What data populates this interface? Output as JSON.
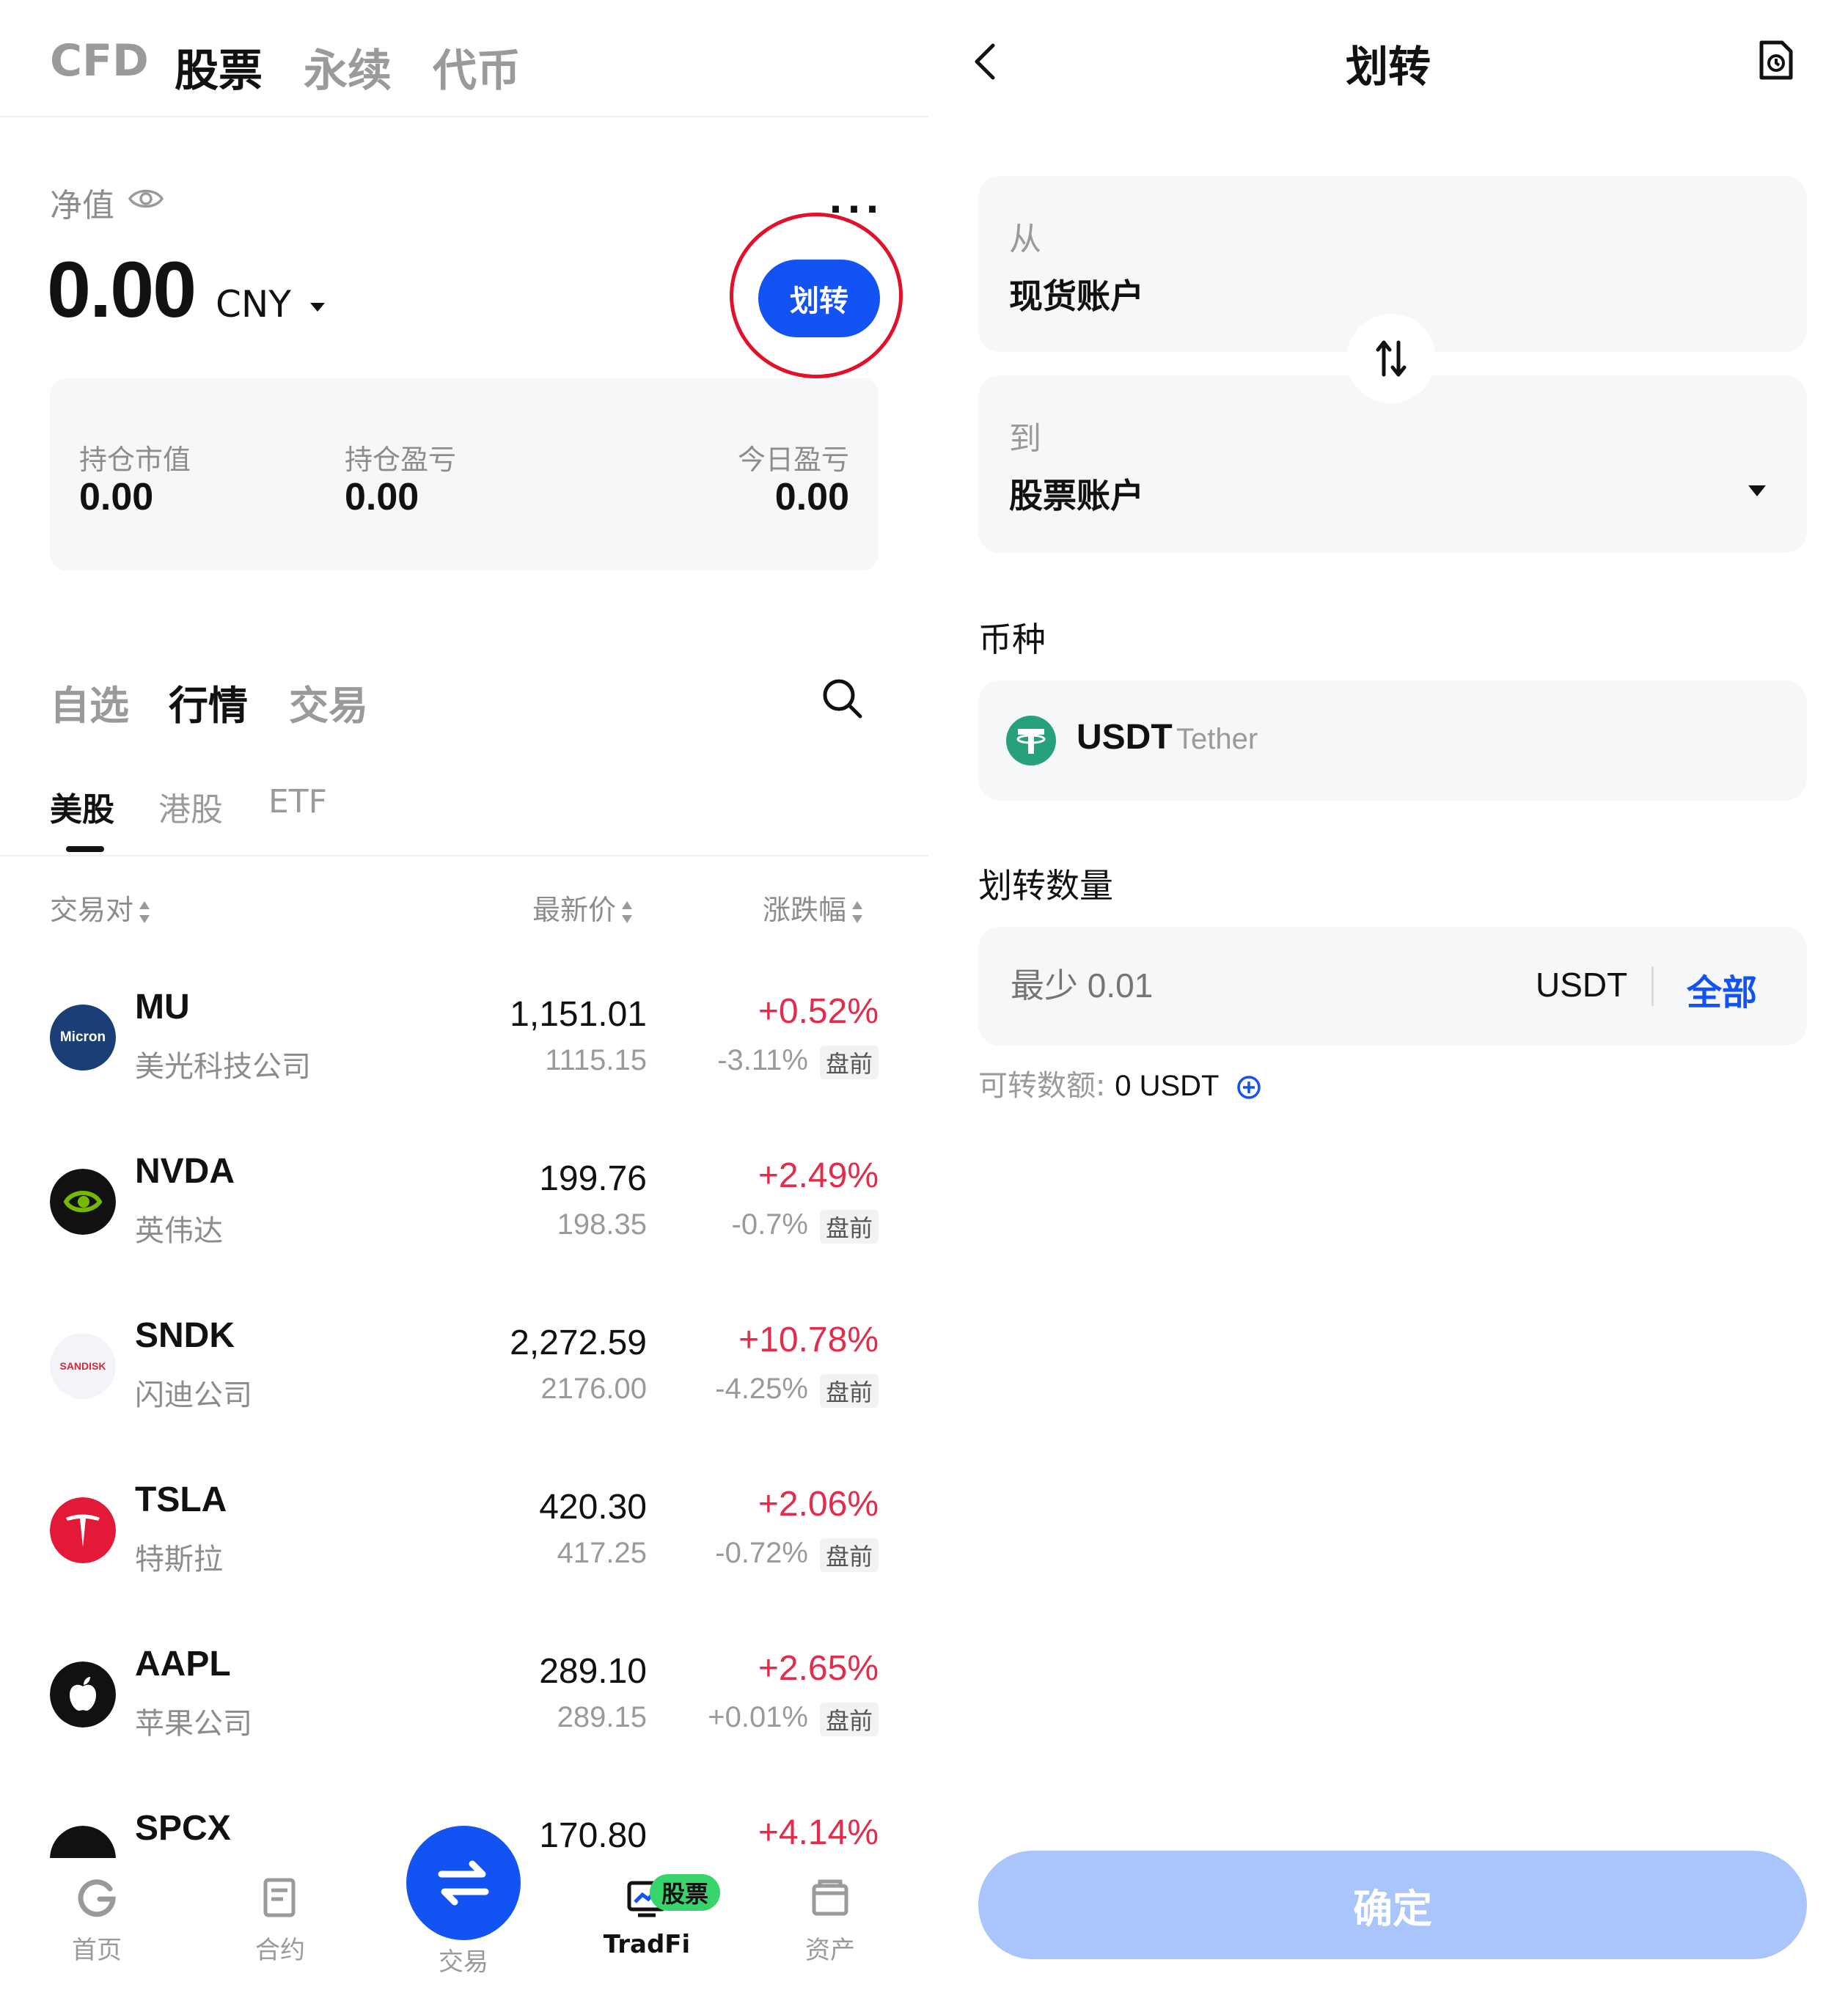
{
  "left": {
    "top_tabs": [
      "CFD",
      "股票",
      "永续",
      "代币"
    ],
    "net_value_label": "净值",
    "more_label": "...",
    "net_value": "0.00",
    "currency": "CNY",
    "transfer_label": "划转",
    "stats": [
      {
        "label": "持仓市值",
        "value": "0.00"
      },
      {
        "label": "持仓盈亏",
        "value": "0.00"
      },
      {
        "label": "今日盈亏",
        "value": "0.00"
      }
    ],
    "sub_tabs": [
      "自选",
      "行情",
      "交易"
    ],
    "market_tabs": [
      "美股",
      "港股",
      "ETF"
    ],
    "columns": [
      "交易对",
      "最新价",
      "涨跌幅"
    ],
    "rows": [
      {
        "symbol": "MU",
        "name": "美光科技公司",
        "price": "1,151.01",
        "pre_price": "1115.15",
        "change": "+0.52%",
        "pre_change": "-3.11%",
        "badge": "盘前",
        "logo_text": "Micron"
      },
      {
        "symbol": "NVDA",
        "name": "英伟达",
        "price": "199.76",
        "pre_price": "198.35",
        "change": "+2.49%",
        "pre_change": "-0.7%",
        "badge": "盘前",
        "logo_text": ""
      },
      {
        "symbol": "SNDK",
        "name": "闪迪公司",
        "price": "2,272.59",
        "pre_price": "2176.00",
        "change": "+10.78%",
        "pre_change": "-4.25%",
        "badge": "盘前",
        "logo_text": "SANDISK"
      },
      {
        "symbol": "TSLA",
        "name": "特斯拉",
        "price": "420.30",
        "pre_price": "417.25",
        "change": "+2.06%",
        "pre_change": "-0.72%",
        "badge": "盘前",
        "logo_text": ""
      },
      {
        "symbol": "AAPL",
        "name": "苹果公司",
        "price": "289.10",
        "pre_price": "289.15",
        "change": "+2.65%",
        "pre_change": "+0.01%",
        "badge": "盘前",
        "logo_text": ""
      },
      {
        "symbol": "SPCX",
        "name": "",
        "price": "170.80",
        "pre_price": "",
        "change": "+4.14%",
        "pre_change": "",
        "badge": "",
        "logo_text": ""
      }
    ],
    "nav": [
      "首页",
      "合约",
      "交易",
      "TradFi",
      "资产"
    ],
    "nav_badge": "股票",
    "colors": {
      "accent": "#1352f3",
      "up": "#e12d4b",
      "badge": "#36d46a"
    }
  },
  "right": {
    "title": "划转",
    "from_label": "从",
    "from_value": "现货账户",
    "to_label": "到",
    "to_value": "股票账户",
    "coin_section": "币种",
    "coin_symbol": "USDT",
    "coin_name": "Tether",
    "amount_section": "划转数量",
    "amount_placeholder": "最少 0.01",
    "amount_unit": "USDT",
    "all_label": "全部",
    "available_label": "可转数额:",
    "available_value": "0 USDT",
    "confirm_label": "确定"
  }
}
